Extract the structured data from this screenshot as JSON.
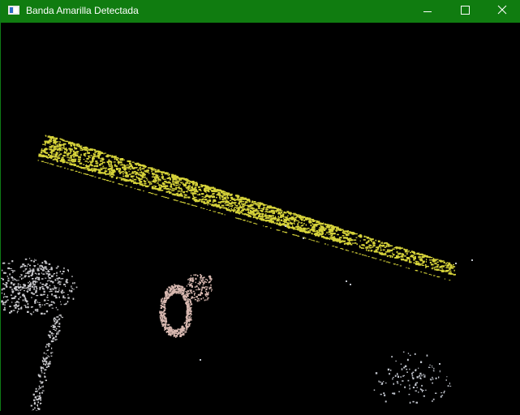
{
  "window": {
    "title": "Banda Amarilla Detectada",
    "icon": "app-window-icon",
    "title_bar_color": "#107c10",
    "controls": [
      "minimize-icon",
      "maximize-icon",
      "close-icon"
    ]
  },
  "image": {
    "background_color": "#000000",
    "regions": [
      {
        "name": "yellow-band",
        "color": "#d6d33a"
      },
      {
        "name": "grey-blob-left",
        "color": "#c8c8cc"
      },
      {
        "name": "pink-blob-center",
        "color": "#d8b8b0"
      },
      {
        "name": "grey-blob-bottom-right",
        "color": "#c0c4cc"
      }
    ]
  }
}
